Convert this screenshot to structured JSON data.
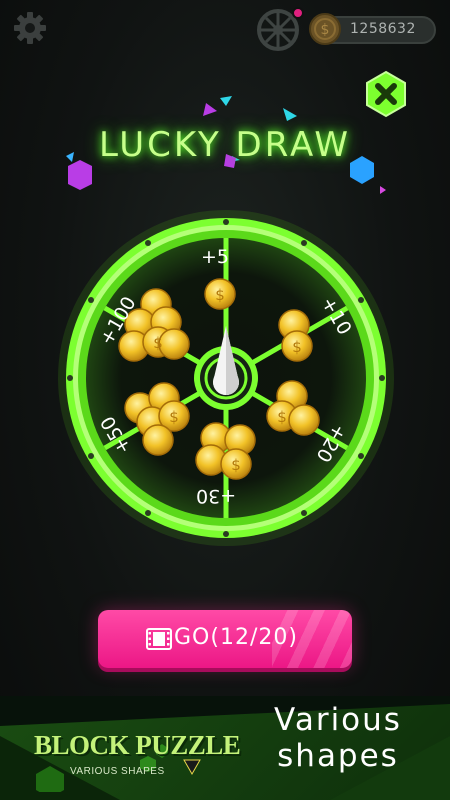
{
  "header": {
    "coins": "1258632",
    "icons": [
      "gear-icon",
      "wheel-icon",
      "coin-icon"
    ]
  },
  "popup": {
    "title": "LUCKY DRAW",
    "close_icon": "close-icon",
    "segments": [
      {
        "label": "+5"
      },
      {
        "label": "+10"
      },
      {
        "label": "+20"
      },
      {
        "label": "+30"
      },
      {
        "label": "+50"
      },
      {
        "label": "+100"
      }
    ],
    "go_button": {
      "label": "GO(12/20)",
      "icon": "film-icon"
    }
  },
  "banner": {
    "logo_title": "BLOCK PUZZLE",
    "logo_subtitle": "VARIOUS SHAPES",
    "tagline_line1": "Various",
    "tagline_line2": "shapes"
  },
  "colors": {
    "accent_green": "#8cff3a",
    "button_pink": "#f3208d",
    "background": "#121514"
  }
}
